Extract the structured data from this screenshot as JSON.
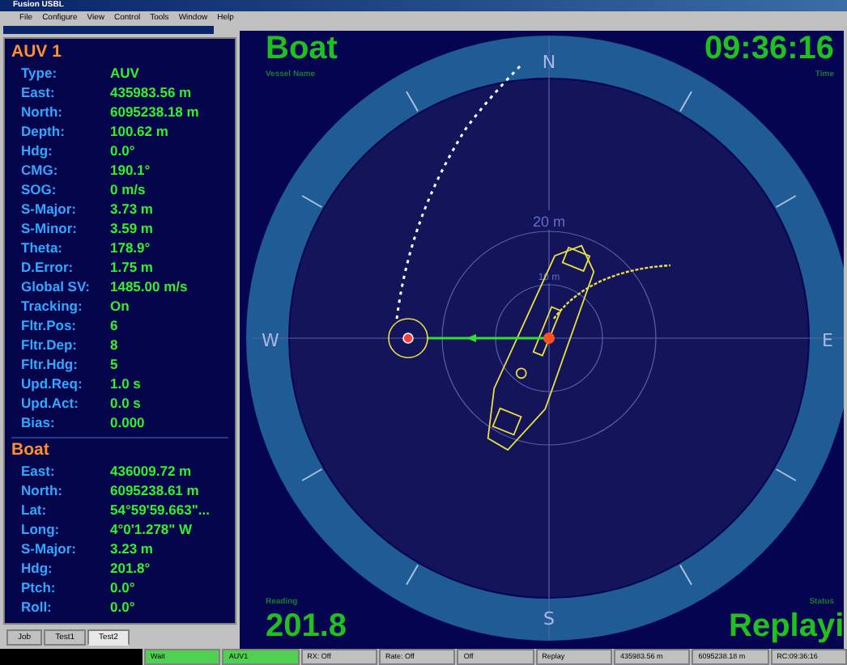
{
  "window": {
    "title": "Fusion USBL"
  },
  "menu": [
    "File",
    "Configure",
    "View",
    "Control",
    "Tools",
    "Window",
    "Help"
  ],
  "auv": {
    "title": "AUV 1",
    "fields": [
      {
        "label": "Type:",
        "value": "AUV"
      },
      {
        "label": "East:",
        "value": "435983.56 m"
      },
      {
        "label": "North:",
        "value": "6095238.18 m"
      },
      {
        "label": "Depth:",
        "value": "100.62 m"
      },
      {
        "label": "Hdg:",
        "value": "0.0°"
      },
      {
        "label": "CMG:",
        "value": "190.1°"
      },
      {
        "label": "SOG:",
        "value": "0 m/s"
      },
      {
        "label": "S-Major:",
        "value": "3.73 m"
      },
      {
        "label": "S-Minor:",
        "value": "3.59 m"
      },
      {
        "label": "Theta:",
        "value": "178.9°"
      },
      {
        "label": "D.Error:",
        "value": "1.75 m"
      },
      {
        "label": "Global SV:",
        "value": "1485.00 m/s"
      },
      {
        "label": "Tracking:",
        "value": "On"
      },
      {
        "label": "Fltr.Pos:",
        "value": "6"
      },
      {
        "label": "Fltr.Dep:",
        "value": "8"
      },
      {
        "label": "Fltr.Hdg:",
        "value": "5"
      },
      {
        "label": "Upd.Req:",
        "value": "1.0 s"
      },
      {
        "label": "Upd.Act:",
        "value": "0.0 s"
      },
      {
        "label": "Bias:",
        "value": "0.000"
      }
    ]
  },
  "boat": {
    "title": "Boat",
    "fields": [
      {
        "label": "East:",
        "value": "436009.72 m"
      },
      {
        "label": "North:",
        "value": "6095238.61 m"
      },
      {
        "label": "Lat:",
        "value": "54°59'59.663\"..."
      },
      {
        "label": "Long:",
        "value": "4°0'1.278\" W"
      },
      {
        "label": "S-Major:",
        "value": "3.23 m"
      },
      {
        "label": "Hdg:",
        "value": "201.8°"
      },
      {
        "label": "Ptch:",
        "value": "0.0°"
      },
      {
        "label": "Roll:",
        "value": "0.0°"
      }
    ]
  },
  "tabs": [
    {
      "label": "Job",
      "selected": false
    },
    {
      "label": "Test1",
      "selected": false
    },
    {
      "label": "Test2",
      "selected": true
    }
  ],
  "display": {
    "vessel_name": "Boat",
    "vessel_name_label": "Vessel Name",
    "time": "09:36:16",
    "time_label": "Time",
    "reading_label": "Reading",
    "reading": "201.8",
    "status_label": "Status",
    "status": "Replayi",
    "compass": [
      "N",
      "E",
      "S",
      "W"
    ],
    "ranges": [
      "20 m",
      "10 m"
    ]
  },
  "status_bar": [
    {
      "text": "Wait",
      "kind": "green"
    },
    {
      "text": "AUV1",
      "kind": "green"
    },
    {
      "text": "RX: Off",
      "kind": "plain"
    },
    {
      "text": "Rate: Off",
      "kind": "plain"
    },
    {
      "text": "Off",
      "kind": "plain"
    },
    {
      "text": "Replay",
      "kind": "plain"
    },
    {
      "text": "435983.56 m",
      "kind": "plain"
    },
    {
      "text": "6095238.18 m",
      "kind": "plain"
    },
    {
      "text": "RC:09:36:16",
      "kind": "plain"
    }
  ]
}
